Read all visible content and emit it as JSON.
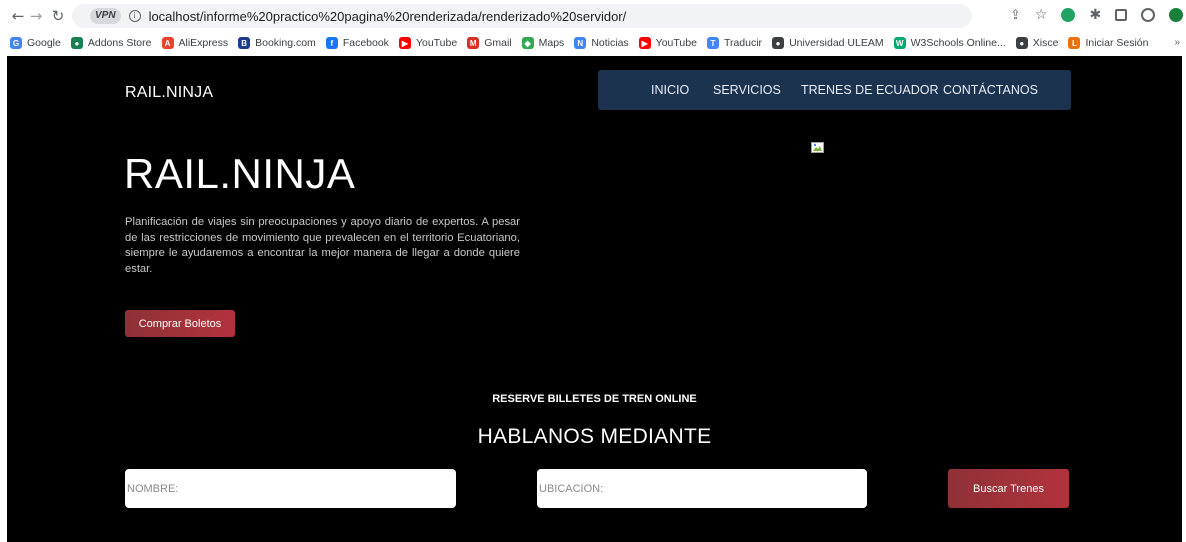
{
  "browser": {
    "vpn_label": "VPN",
    "url": "localhost/informe%20practico%20pagina%20renderizada/renderizado%20servidor/",
    "bookmarks": [
      {
        "label": "Google",
        "color": "#4285f4",
        "glyph": "G"
      },
      {
        "label": "Addons Store",
        "color": "#1a7f52",
        "glyph": "●"
      },
      {
        "label": "AliExpress",
        "color": "#e8432f",
        "glyph": "A"
      },
      {
        "label": "Booking.com",
        "color": "#1e3a8a",
        "glyph": "B"
      },
      {
        "label": "Facebook",
        "color": "#1877f2",
        "glyph": "f"
      },
      {
        "label": "YouTube",
        "color": "#ff0000",
        "glyph": "▶"
      },
      {
        "label": "Gmail",
        "color": "#d93025",
        "glyph": "M"
      },
      {
        "label": "Maps",
        "color": "#34a853",
        "glyph": "◆"
      },
      {
        "label": "Noticias",
        "color": "#4285f4",
        "glyph": "N"
      },
      {
        "label": "YouTube",
        "color": "#ff0000",
        "glyph": "▶"
      },
      {
        "label": "Traducir",
        "color": "#4285f4",
        "glyph": "T"
      },
      {
        "label": "Universidad ULEAM",
        "color": "#3c4043",
        "glyph": "●"
      },
      {
        "label": "W3Schools Online...",
        "color": "#04aa6d",
        "glyph": "W"
      },
      {
        "label": "Xisce",
        "color": "#3c4043",
        "glyph": "●"
      },
      {
        "label": "Iniciar Sesión",
        "color": "#e8710a",
        "glyph": "L"
      }
    ],
    "more_label": "»"
  },
  "site": {
    "brand": "RAIL.NINJA",
    "nav": [
      "INICIO",
      "SERVICIOS",
      "TRENES DE ECUADOR",
      "CONTÁCTANOS"
    ],
    "hero": {
      "title": "RAIL.NINJA",
      "text": "Planificación de viajes sin preocupaciones y apoyo diario de expertos. A pesar de las restricciones de movimiento que prevalecen en el territorio Ecuatoriano, siempre le ayudaremos a encontrar la mejor manera de llegar a donde quiere estar.",
      "button": "Comprar Boletos"
    },
    "booking": {
      "subheading": "RESERVE BILLETES DE TREN ONLINE",
      "heading": "HABLANOS MEDIANTE",
      "name_placeholder": "NOMBRE:",
      "location_placeholder": "UBICACION:",
      "search_button": "Buscar Trenes"
    },
    "colors": {
      "nav_bg": "#1c3350",
      "button_red": "#b2323c",
      "page_bg": "#000000"
    }
  }
}
